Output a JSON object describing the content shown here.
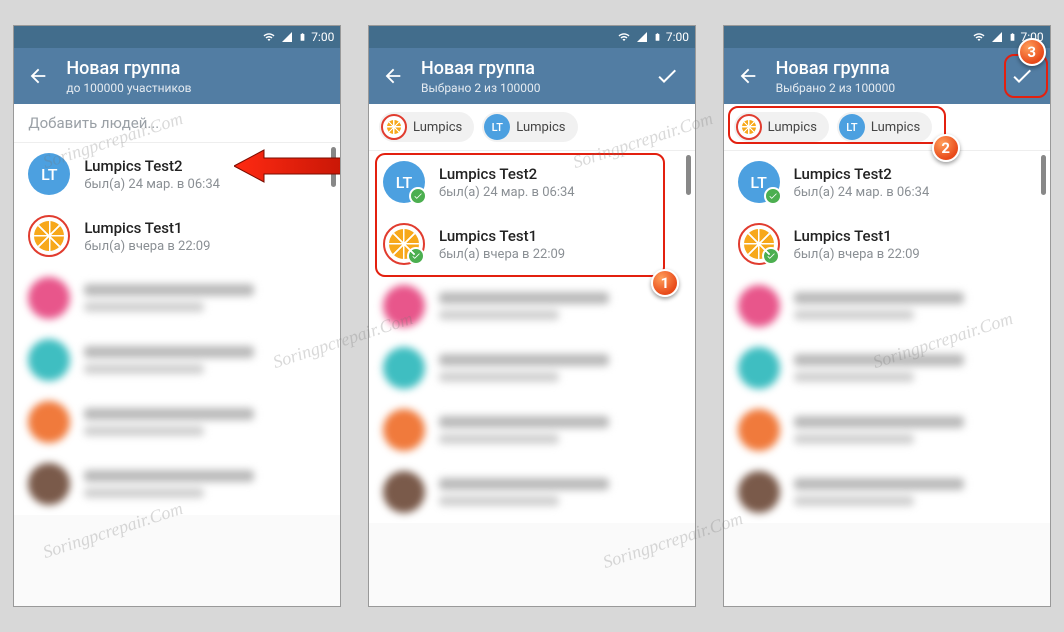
{
  "statusbar": {
    "time": "7:00"
  },
  "screens": {
    "s1": {
      "title": "Новая группа",
      "subtitle": "до 100000 участников",
      "search_placeholder": "Добавить людей..."
    },
    "s2": {
      "title": "Новая группа",
      "subtitle": "Выбрано 2 из 100000"
    },
    "s3": {
      "title": "Новая группа",
      "subtitle": "Выбрано 2 из 100000"
    }
  },
  "chips": [
    {
      "label": "Lumpics",
      "avatar_type": "orange"
    },
    {
      "label": "Lumpics",
      "avatar_type": "lt",
      "avatar_text": "LT"
    }
  ],
  "contacts": [
    {
      "name": "Lumpics Test2",
      "status": "был(а) 24 мар. в 06:34",
      "avatar_type": "lt",
      "avatar_text": "LT"
    },
    {
      "name": "Lumpics Test1",
      "status": "был(а) вчера в 22:09",
      "avatar_type": "orange"
    }
  ],
  "blurred_avatar_colors": [
    "#e8568b",
    "#3fbec1",
    "#f07a3c",
    "#7a5a4a"
  ],
  "annotations": {
    "badge1": "1",
    "badge2": "2",
    "badge3": "3"
  },
  "watermark": "Soringpcrepair.Com"
}
